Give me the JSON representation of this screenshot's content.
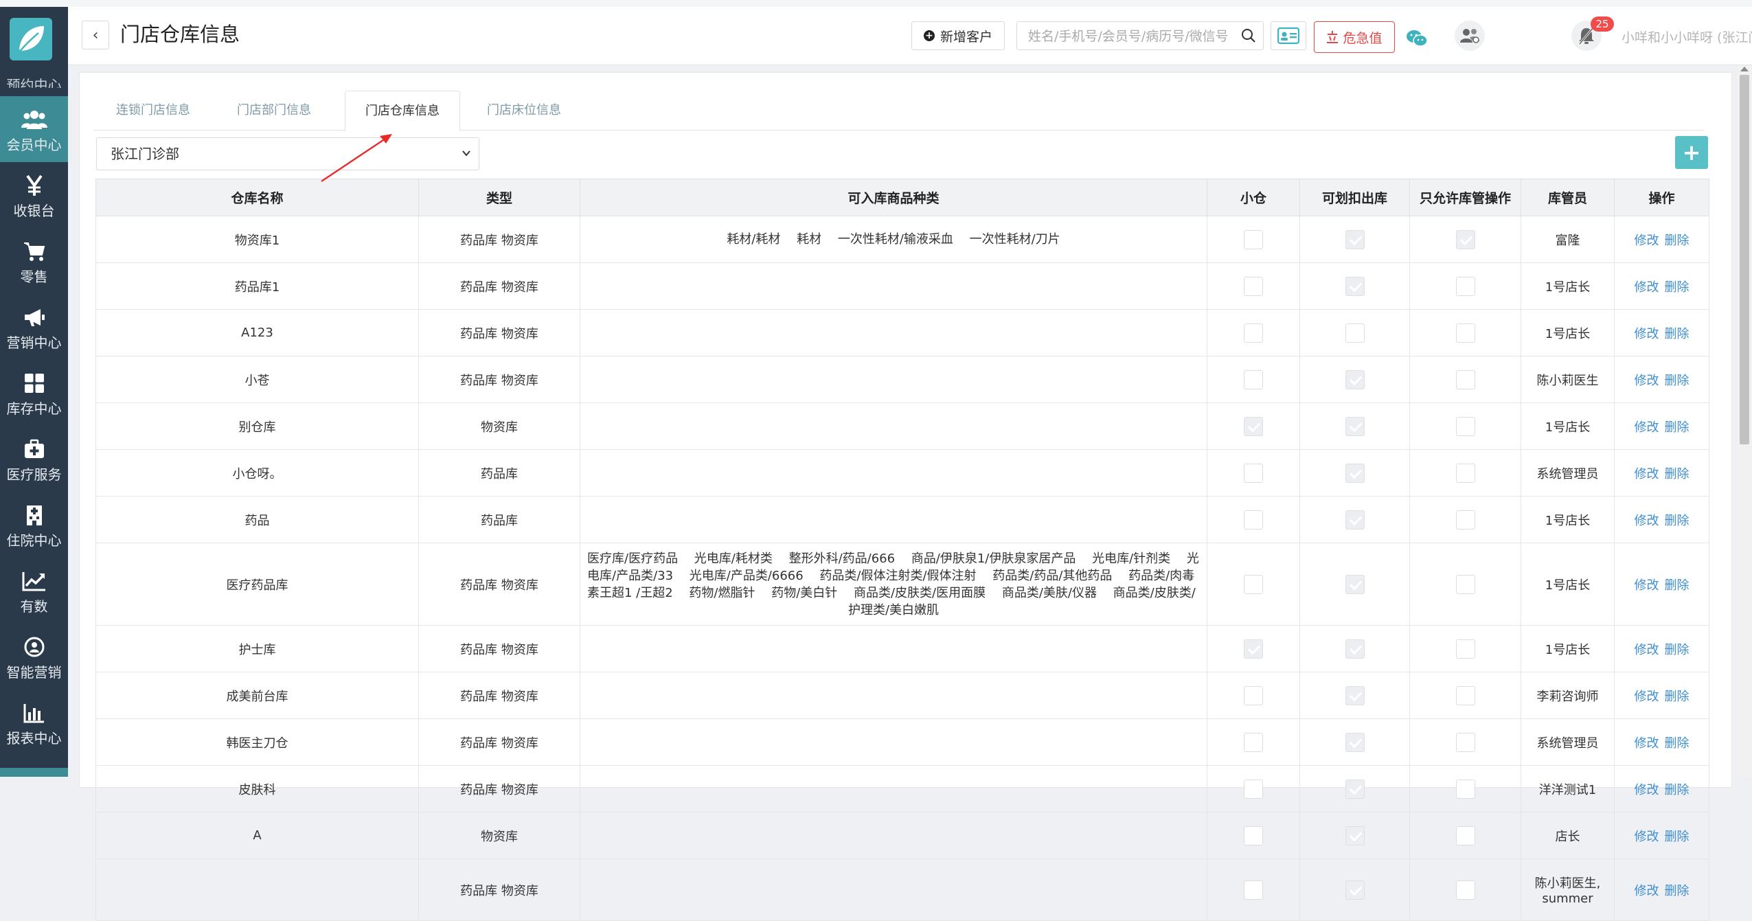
{
  "sidebar": {
    "cut_label": "预约中心",
    "items": [
      {
        "label": "会员中心",
        "icon": "members-icon",
        "active": true
      },
      {
        "label": "收银台",
        "icon": "yen-icon",
        "active": false
      },
      {
        "label": "零售",
        "icon": "cart-icon",
        "active": false
      },
      {
        "label": "营销中心",
        "icon": "megaphone-icon",
        "active": false
      },
      {
        "label": "库存中心",
        "icon": "grid-icon",
        "active": false
      },
      {
        "label": "医疗服务",
        "icon": "medkit-icon",
        "active": false
      },
      {
        "label": "住院中心",
        "icon": "hospital-icon",
        "active": false
      },
      {
        "label": "有数",
        "icon": "trend-icon",
        "active": false
      },
      {
        "label": "智能营销",
        "icon": "smart-icon",
        "active": false
      },
      {
        "label": "报表中心",
        "icon": "bar-chart-icon",
        "active": false
      }
    ]
  },
  "header": {
    "back_label": "‹",
    "title": "门店仓库信息",
    "add_customer": "新增客户",
    "search_placeholder": "姓名/手机号/会员号/病历号/微信号",
    "danger_label": "危急值",
    "notify_count": "25",
    "user": "小咩和小小咩呀 (张江门诊部)"
  },
  "tabs": [
    {
      "label": "连锁门店信息",
      "active": false
    },
    {
      "label": "门店部门信息",
      "active": false
    },
    {
      "label": "门店仓库信息",
      "active": true
    },
    {
      "label": "门店床位信息",
      "active": false
    }
  ],
  "store_select": {
    "value": "张江门诊部"
  },
  "add_button": "+",
  "table": {
    "columns": [
      "仓库名称",
      "类型",
      "可入库商品种类",
      "小仓",
      "可划扣出库",
      "只允许库管操作",
      "库管员",
      "操作"
    ],
    "actions": [
      "修改",
      "删除"
    ],
    "rows": [
      {
        "name": "物资库1",
        "type": "药品库 物资库",
        "goods": "耗材/耗材　 耗材　 一次性耗材/输液采血　 一次性耗材/刀片",
        "small": false,
        "deduct": true,
        "admin_only": true,
        "keeper": "富隆"
      },
      {
        "name": "药品库1",
        "type": "药品库 物资库",
        "goods": "",
        "small": false,
        "deduct": true,
        "admin_only": false,
        "keeper": "1号店长"
      },
      {
        "name": "A123",
        "type": "药品库 物资库",
        "goods": "",
        "small": false,
        "deduct": false,
        "admin_only": false,
        "keeper": "1号店长"
      },
      {
        "name": "小苍",
        "type": "药品库 物资库",
        "goods": "",
        "small": false,
        "deduct": true,
        "admin_only": false,
        "keeper": "陈小莉医生"
      },
      {
        "name": "别仓库",
        "type": "物资库",
        "goods": "",
        "small": true,
        "deduct": true,
        "admin_only": false,
        "keeper": "1号店长"
      },
      {
        "name": "小仓呀。",
        "type": "药品库",
        "goods": "",
        "small": false,
        "deduct": true,
        "admin_only": false,
        "keeper": "系统管理员"
      },
      {
        "name": "药品",
        "type": "药品库",
        "goods": "",
        "small": false,
        "deduct": true,
        "admin_only": false,
        "keeper": "1号店长"
      },
      {
        "name": "医疗药品库",
        "type": "药品库 物资库",
        "goods": "医疗库/医疗药品　 光电库/耗材类　 整形外科/药品/666　 商品/伊肤泉1/伊肤泉家居产品　 光电库/针剂类　 光电库/产品类/33　 光电库/产品类/6666　 药品类/假体注射类/假体注射　 药品类/药品/其他药品　 药品类/肉毒素王超1 /王超2　 药物/燃脂针　 药物/美白针　 商品类/皮肤类/医用面膜　 商品类/美肤/仪器　 商品类/皮肤类/护理类/美白嫩肌",
        "small": false,
        "deduct": true,
        "admin_only": false,
        "keeper": "1号店长"
      },
      {
        "name": "护士库",
        "type": "药品库 物资库",
        "goods": "",
        "small": true,
        "deduct": true,
        "admin_only": false,
        "keeper": "1号店长"
      },
      {
        "name": "成美前台库",
        "type": "药品库 物资库",
        "goods": "",
        "small": false,
        "deduct": true,
        "admin_only": false,
        "keeper": "李莉咨询师"
      },
      {
        "name": "韩医主刀仓",
        "type": "药品库 物资库",
        "goods": "",
        "small": false,
        "deduct": true,
        "admin_only": false,
        "keeper": "系统管理员"
      },
      {
        "name": "皮肤科",
        "type": "药品库 物资库",
        "goods": "",
        "small": false,
        "deduct": true,
        "admin_only": false,
        "keeper": "洋洋测试1"
      },
      {
        "name": "A",
        "type": "物资库",
        "goods": "",
        "small": false,
        "deduct": true,
        "admin_only": false,
        "keeper": "店长"
      },
      {
        "name": "",
        "type": "药品库 物资库",
        "goods": "",
        "small": false,
        "deduct": true,
        "admin_only": false,
        "keeper": "陈小莉医生, summer"
      }
    ]
  }
}
